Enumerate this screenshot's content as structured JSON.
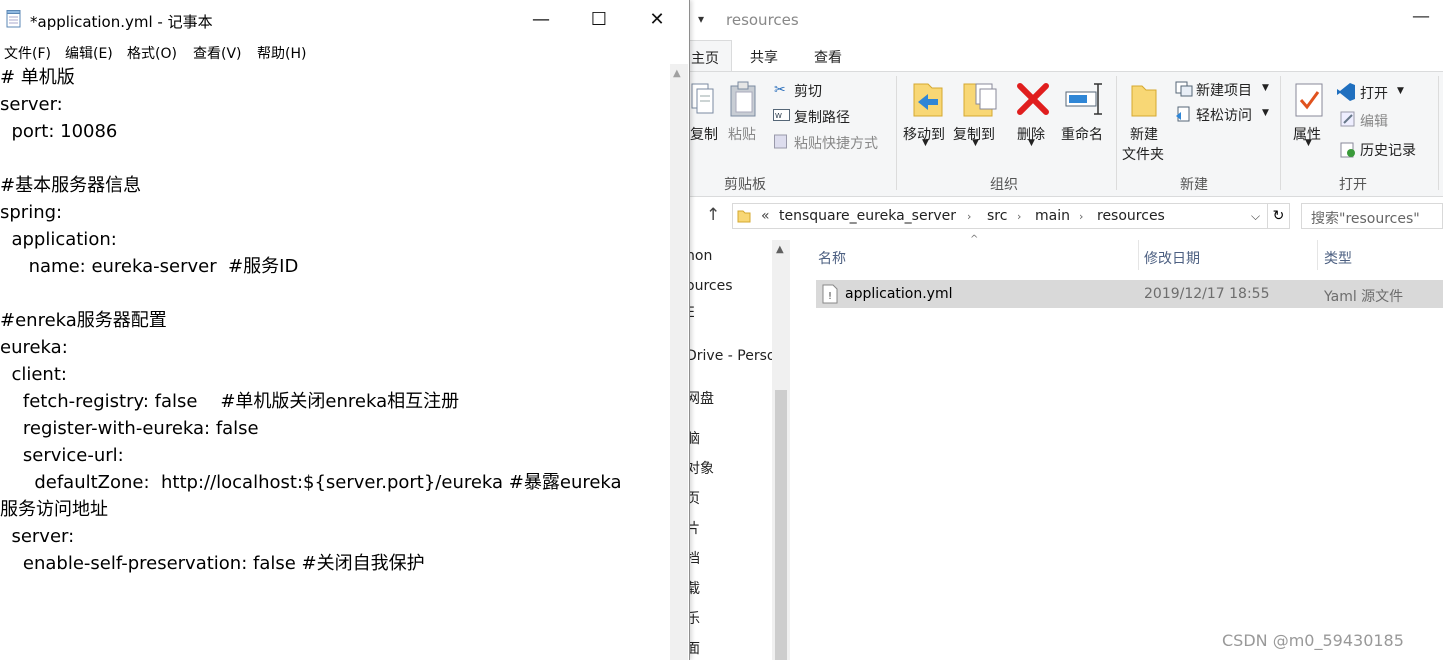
{
  "explorer": {
    "title": "resources",
    "tabs": [
      "主页",
      "共享",
      "查看"
    ],
    "ribbon": {
      "clipboard": {
        "copy": "复制",
        "paste": "粘贴",
        "cut": "剪切",
        "copy_path": "复制路径",
        "paste_shortcut": "粘贴快捷方式",
        "label": "剪贴板"
      },
      "organize": {
        "move_to": "移动到",
        "copy_to": "复制到",
        "delete": "删除",
        "rename": "重命名",
        "label": "组织"
      },
      "new": {
        "new_folder": "新建\n文件夹",
        "new_folder_line1": "新建",
        "new_folder_line2": "文件夹",
        "new_item": "新建项目",
        "easy_access": "轻松访问",
        "label": "新建"
      },
      "open": {
        "properties": "属性",
        "open": "打开",
        "edit": "编辑",
        "history": "历史记录",
        "label": "打开"
      }
    },
    "address": {
      "prefix": "«",
      "crumbs": [
        "tensquare_eureka_server",
        "src",
        "main",
        "resources"
      ],
      "search_placeholder": "搜索\"resources\""
    },
    "nav_items": [
      "hon",
      "ources",
      "E",
      "Drive - Perso",
      "网盘",
      "脑",
      "对象",
      "页",
      "片",
      "档",
      "载",
      "乐",
      "面"
    ],
    "columns": {
      "name": "名称",
      "modified": "修改日期",
      "type": "类型"
    },
    "files": [
      {
        "name": "application.yml",
        "modified": "2019/12/17 18:55",
        "type": "Yaml 源文件"
      }
    ]
  },
  "notepad": {
    "title": "*application.yml - 记事本",
    "menu": [
      "文件(F)",
      "编辑(E)",
      "格式(O)",
      "查看(V)",
      "帮助(H)"
    ],
    "content": "# 单机版\nserver:\n  port: 10086\n\n#基本服务器信息\nspring:\n  application:\n     name: eureka-server  #服务ID\n\n#enreka服务器配置\neureka:\n  client:\n    fetch-registry: false    #单机版关闭enreka相互注册\n    register-with-eureka: false\n    service-url:\n      defaultZone:  http://localhost:${server.port}/eureka #暴露eureka\n服务访问地址\n  server:\n    enable-self-preservation: false #关闭自我保护"
  },
  "watermark": "CSDN @m0_59430185",
  "colors": {
    "accent": "#0078d7",
    "selection": "#d9d9d9",
    "header_text": "#4d6082"
  }
}
